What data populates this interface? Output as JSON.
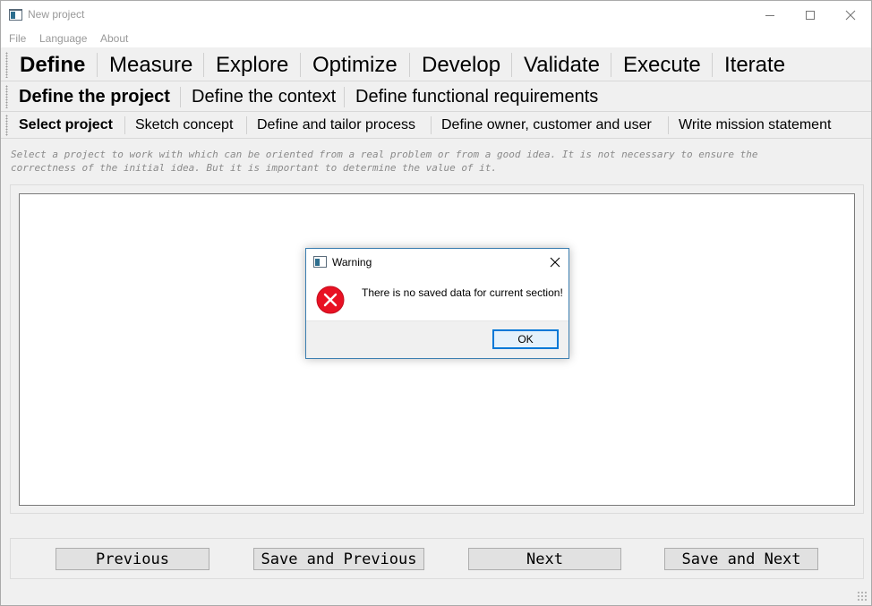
{
  "window": {
    "title": "New project"
  },
  "menu": {
    "items": [
      "File",
      "Language",
      "About"
    ]
  },
  "phase_tabs": [
    "Define",
    "Measure",
    "Explore",
    "Optimize",
    "Develop",
    "Validate",
    "Execute",
    "Iterate"
  ],
  "phase_active": "Define",
  "step_tabs": [
    "Define the project",
    "Define the context",
    "Define functional requirements"
  ],
  "step_active": "Define the project",
  "task_tabs": [
    "Select project",
    "Sketch concept",
    "Define and tailor process",
    "Define owner, customer and user",
    "Write mission statement"
  ],
  "task_active": "Select project",
  "description": {
    "line1": "Select a project to work with which can be oriented from a real problem or from a good idea. It is not necessary to ensure the",
    "line2": "correctness of the initial idea. But it is important to determine the value of it."
  },
  "buttons": {
    "previous": "Previous",
    "save_previous": "Save and Previous",
    "next": "Next",
    "save_next": "Save and Next"
  },
  "dialog": {
    "title": "Warning",
    "message": "There is no saved data for current section!",
    "ok_label": "OK",
    "icon": "error-icon"
  },
  "colors": {
    "error_red": "#e81123",
    "focus_blue": "#0078d7"
  }
}
